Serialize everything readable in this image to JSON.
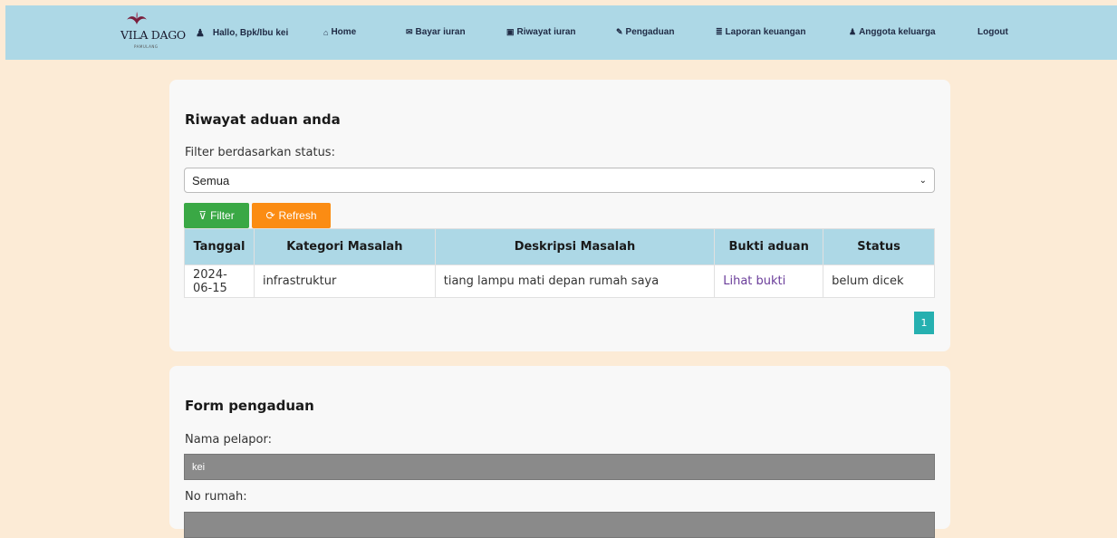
{
  "brand": {
    "name": "VILA DAGO",
    "sub": "PAMULANG"
  },
  "nav": {
    "greeting": "Hallo, Bpk/Ibu kei",
    "items": [
      {
        "icon": "home-icon",
        "glyph": "⌂",
        "label": "Home"
      },
      {
        "icon": "mail-icon",
        "glyph": "✉",
        "label": "Bayar iuran"
      },
      {
        "icon": "book-icon",
        "glyph": "▣",
        "label": "Riwayat iuran"
      },
      {
        "icon": "pencil-icon",
        "glyph": "✎",
        "label": "Pengaduan"
      },
      {
        "icon": "database-icon",
        "glyph": "≣",
        "label": "Laporan keuangan"
      },
      {
        "icon": "users-icon",
        "glyph": "♟",
        "label": "Anggota keluarga"
      },
      {
        "icon": "",
        "glyph": "",
        "label": "Logout"
      }
    ]
  },
  "history": {
    "title": "Riwayat aduan anda",
    "filter_label": "Filter berdasarkan status:",
    "filter_value": "Semua",
    "filter_button": "Filter",
    "refresh_button": "Refresh",
    "columns": [
      "Tanggal",
      "Kategori Masalah",
      "Deskripsi Masalah",
      "Bukti aduan",
      "Status"
    ],
    "rows": [
      {
        "tanggal": "2024-06-15",
        "kategori": "infrastruktur",
        "deskripsi": "tiang lampu mati depan rumah saya",
        "bukti": "Lihat bukti",
        "status": "belum dicek"
      }
    ],
    "page": "1"
  },
  "form": {
    "title": "Form pengaduan",
    "nama_label": "Nama pelapor:",
    "nama_value": "kei",
    "rumah_label": "No rumah:",
    "rumah_value": ""
  },
  "colors": {
    "navbar": "#add8e6",
    "background": "#fcebd6",
    "filter": "#3aa845",
    "refresh": "#fb8c13",
    "pager": "#26b0b0"
  }
}
